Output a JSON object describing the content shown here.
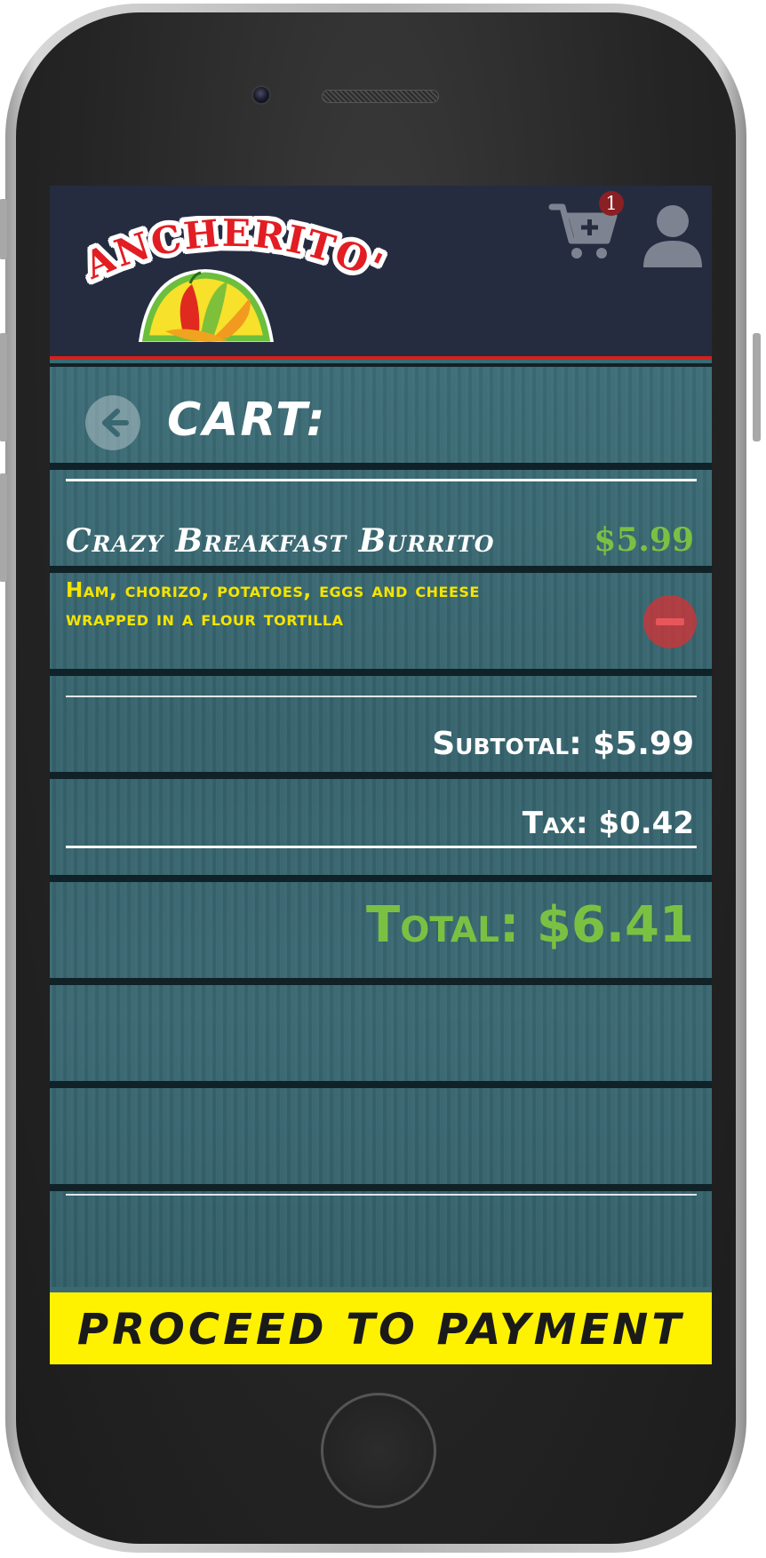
{
  "header": {
    "logo_text": "RANCHERITO'S",
    "cart_badge_count": "1",
    "cart_icon": "cart-plus-icon",
    "user_icon": "user-icon",
    "colors": {
      "bar": "#252c40",
      "accent_line": "#d6201b",
      "badge": "#8a1f24"
    }
  },
  "page": {
    "title": "CART:",
    "back_icon": "arrow-left-circle-icon"
  },
  "cart": {
    "items": [
      {
        "name": "Crazy Breakfast Burrito",
        "price": "$5.99",
        "description": "Ham, chorizo, potatoes, eggs and cheese wrapped in a flour tortilla",
        "remove_icon": "minus-circle-icon"
      }
    ]
  },
  "summary": {
    "subtotal": "Subtotal: $5.99",
    "tax": "Tax: $0.42",
    "total": "Total: $6.41"
  },
  "footer": {
    "proceed_label": "PROCEED TO PAYMENT"
  },
  "colors": {
    "price_green": "#7ac143",
    "description_yellow": "#f5e400",
    "proceed_yellow": "#fff200"
  }
}
